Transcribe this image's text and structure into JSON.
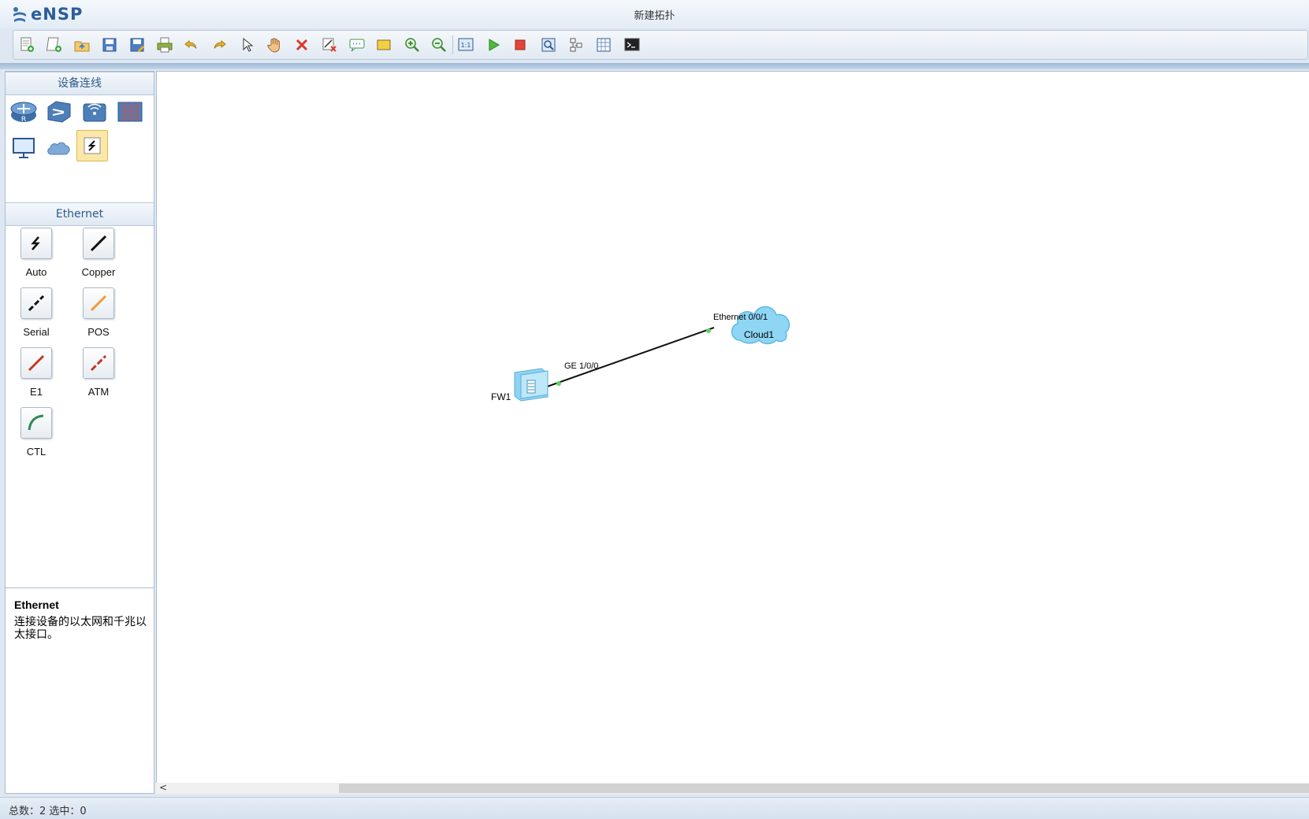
{
  "app": {
    "name": "eNSP",
    "window_title": "新建拓扑"
  },
  "toolbar": {
    "items": [
      {
        "icon": "new-topology-icon"
      },
      {
        "icon": "new-example-icon"
      },
      {
        "icon": "open-icon"
      },
      {
        "icon": "save-icon"
      },
      {
        "icon": "save-as-icon"
      },
      {
        "icon": "print-icon"
      },
      {
        "icon": "undo-icon"
      },
      {
        "icon": "redo-icon"
      },
      {
        "icon": "select-pointer-icon"
      },
      {
        "icon": "pan-hand-icon"
      },
      {
        "icon": "delete-icon"
      },
      {
        "icon": "delete-all-links-icon"
      },
      {
        "icon": "add-text-icon"
      },
      {
        "icon": "add-shape-icon"
      },
      {
        "icon": "zoom-in-icon"
      },
      {
        "icon": "zoom-out-icon"
      },
      {
        "icon": "fit-to-window-icon"
      },
      {
        "icon": "start-device-icon"
      },
      {
        "icon": "stop-device-icon"
      },
      {
        "icon": "capture-data-icon"
      },
      {
        "icon": "show-interfaces-icon"
      },
      {
        "icon": "palette-icon"
      },
      {
        "icon": "command-line-icon"
      }
    ]
  },
  "device_panel": {
    "title": "设备连线",
    "devices": [
      {
        "icon": "router-icon"
      },
      {
        "icon": "switch-icon"
      },
      {
        "icon": "wireless-icon"
      },
      {
        "icon": "firewall-icon"
      },
      {
        "icon": "pc-terminal-icon"
      },
      {
        "icon": "cloud-icon"
      },
      {
        "icon": "connection-icon",
        "selected": true
      }
    ]
  },
  "cable_panel": {
    "title": "Ethernet",
    "cables": [
      {
        "label": "Auto",
        "color": "#111111"
      },
      {
        "label": "Copper",
        "color": "#111111"
      },
      {
        "label": "Serial",
        "color": "#111111"
      },
      {
        "label": "POS",
        "color": "#f39a3a"
      },
      {
        "label": "E1",
        "color": "#c23a1f"
      },
      {
        "label": "ATM",
        "color": "#c23a1f"
      },
      {
        "label": "CTL",
        "color": "#2e8b57"
      }
    ]
  },
  "description": {
    "title": "Ethernet",
    "text": "连接设备的以太网和千兆以太接口。"
  },
  "topology": {
    "nodes": [
      {
        "name": "FW1",
        "type": "firewall"
      },
      {
        "name": "Cloud1",
        "type": "cloud"
      }
    ],
    "link": {
      "from_port": "GE 1/0/0",
      "to_port": "Ethernet 0/0/1",
      "port_status_color": "#5fd35f"
    }
  },
  "scrollbar": {
    "left_arrow": "<"
  },
  "status": {
    "text": "总数：2 选中：0"
  },
  "colors": {
    "accent": "#2b5d9a",
    "panel_header_text": "#2f5b8b"
  }
}
